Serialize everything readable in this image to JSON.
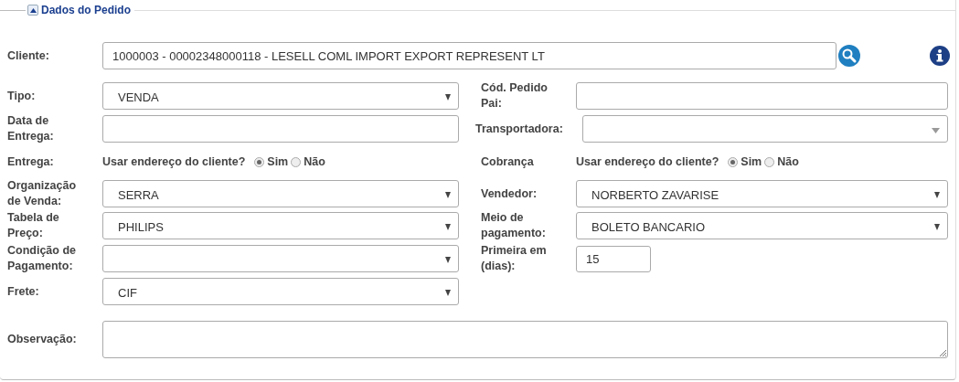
{
  "panel": {
    "title": "Dados do Pedido",
    "expanded": true
  },
  "cliente": {
    "label": "Cliente:",
    "value": "1000003 - 00002348000118 - LESELL COML IMPORT EXPORT REPRESENT LT"
  },
  "rows": [
    {
      "left": {
        "label": "Tipo:",
        "kind": "select",
        "value": "VENDA"
      },
      "right": {
        "label": "Cód. Pedido Pai:",
        "kind": "text"
      }
    },
    {
      "left": {
        "label": "Data de Entrega:",
        "kind": "date"
      },
      "right": {
        "label": "Transportadora:",
        "kind": "combo"
      }
    },
    {
      "left": {
        "label": "Entrega:",
        "kind": "radio",
        "question": "Usar endereço do cliente?",
        "options": [
          {
            "label": "Sim",
            "selected": true
          },
          {
            "label": "Não",
            "selected": false
          }
        ]
      },
      "right": {
        "label": "Cobrança",
        "kind": "radio",
        "question": "Usar endereço do cliente?",
        "options": [
          {
            "label": "Sim",
            "selected": true
          },
          {
            "label": "Não",
            "selected": false
          }
        ]
      }
    },
    {
      "left": {
        "label": "Organização de Venda:",
        "kind": "select",
        "value": "SERRA"
      },
      "right": {
        "label": "Vendedor:",
        "kind": "select",
        "value": "NORBERTO ZAVARISE"
      }
    },
    {
      "left": {
        "label": "Tabela de Preço:",
        "kind": "select",
        "value": "PHILIPS"
      },
      "right": {
        "label": "Meio de pagamento:",
        "kind": "select",
        "value": "BOLETO BANCARIO"
      }
    },
    {
      "left": {
        "label": "Condição de Pagamento:",
        "kind": "select"
      },
      "right": {
        "label": "Primeira em (dias):",
        "kind": "number",
        "value": "15"
      }
    },
    {
      "left": {
        "label": "Frete:",
        "kind": "select",
        "value": "CIF"
      }
    }
  ],
  "observacao": {
    "label": "Observação:"
  }
}
